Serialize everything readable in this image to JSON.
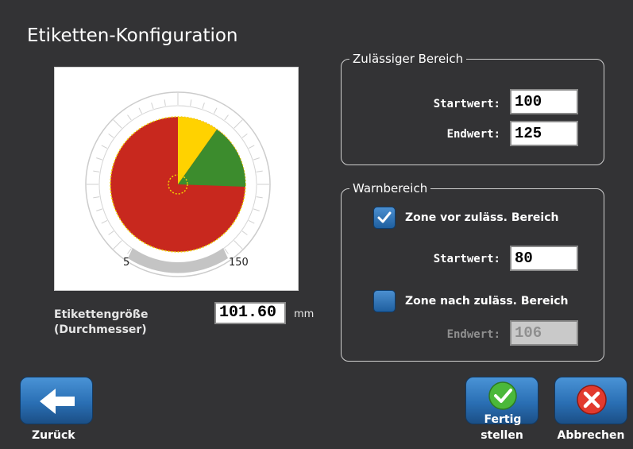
{
  "title": "Etiketten-Konfiguration",
  "preview": {
    "scale_min": "5",
    "scale_max": "150",
    "colors": {
      "red": "#c8281e",
      "yellow": "#ffd200",
      "green": "#3c8c2d"
    }
  },
  "label_size": {
    "label_line1": "Etikettengröße",
    "label_line2": "(Durchmesser)",
    "value": "101.60",
    "unit": "mm"
  },
  "allowed_range": {
    "legend": "Zulässiger Bereich",
    "start_label": "Startwert:",
    "start_value": "100",
    "end_label": "Endwert:",
    "end_value": "125"
  },
  "warning_range": {
    "legend": "Warnbereich",
    "before_zone": {
      "label": "Zone vor zuläss. Bereich",
      "checked": true
    },
    "start_label": "Startwert:",
    "start_value": "80",
    "after_zone": {
      "label": "Zone nach zuläss. Bereich",
      "checked": false
    },
    "end_label": "Endwert:",
    "end_value": "106",
    "end_disabled": true
  },
  "buttons": {
    "back_label": "Zurück",
    "finish_line1": "Fertig",
    "finish_line2": "stellen",
    "cancel_label": "Abbrechen"
  },
  "icons": {
    "back": "arrow-left-icon",
    "finish": "check-circle-icon",
    "cancel": "x-circle-icon"
  }
}
